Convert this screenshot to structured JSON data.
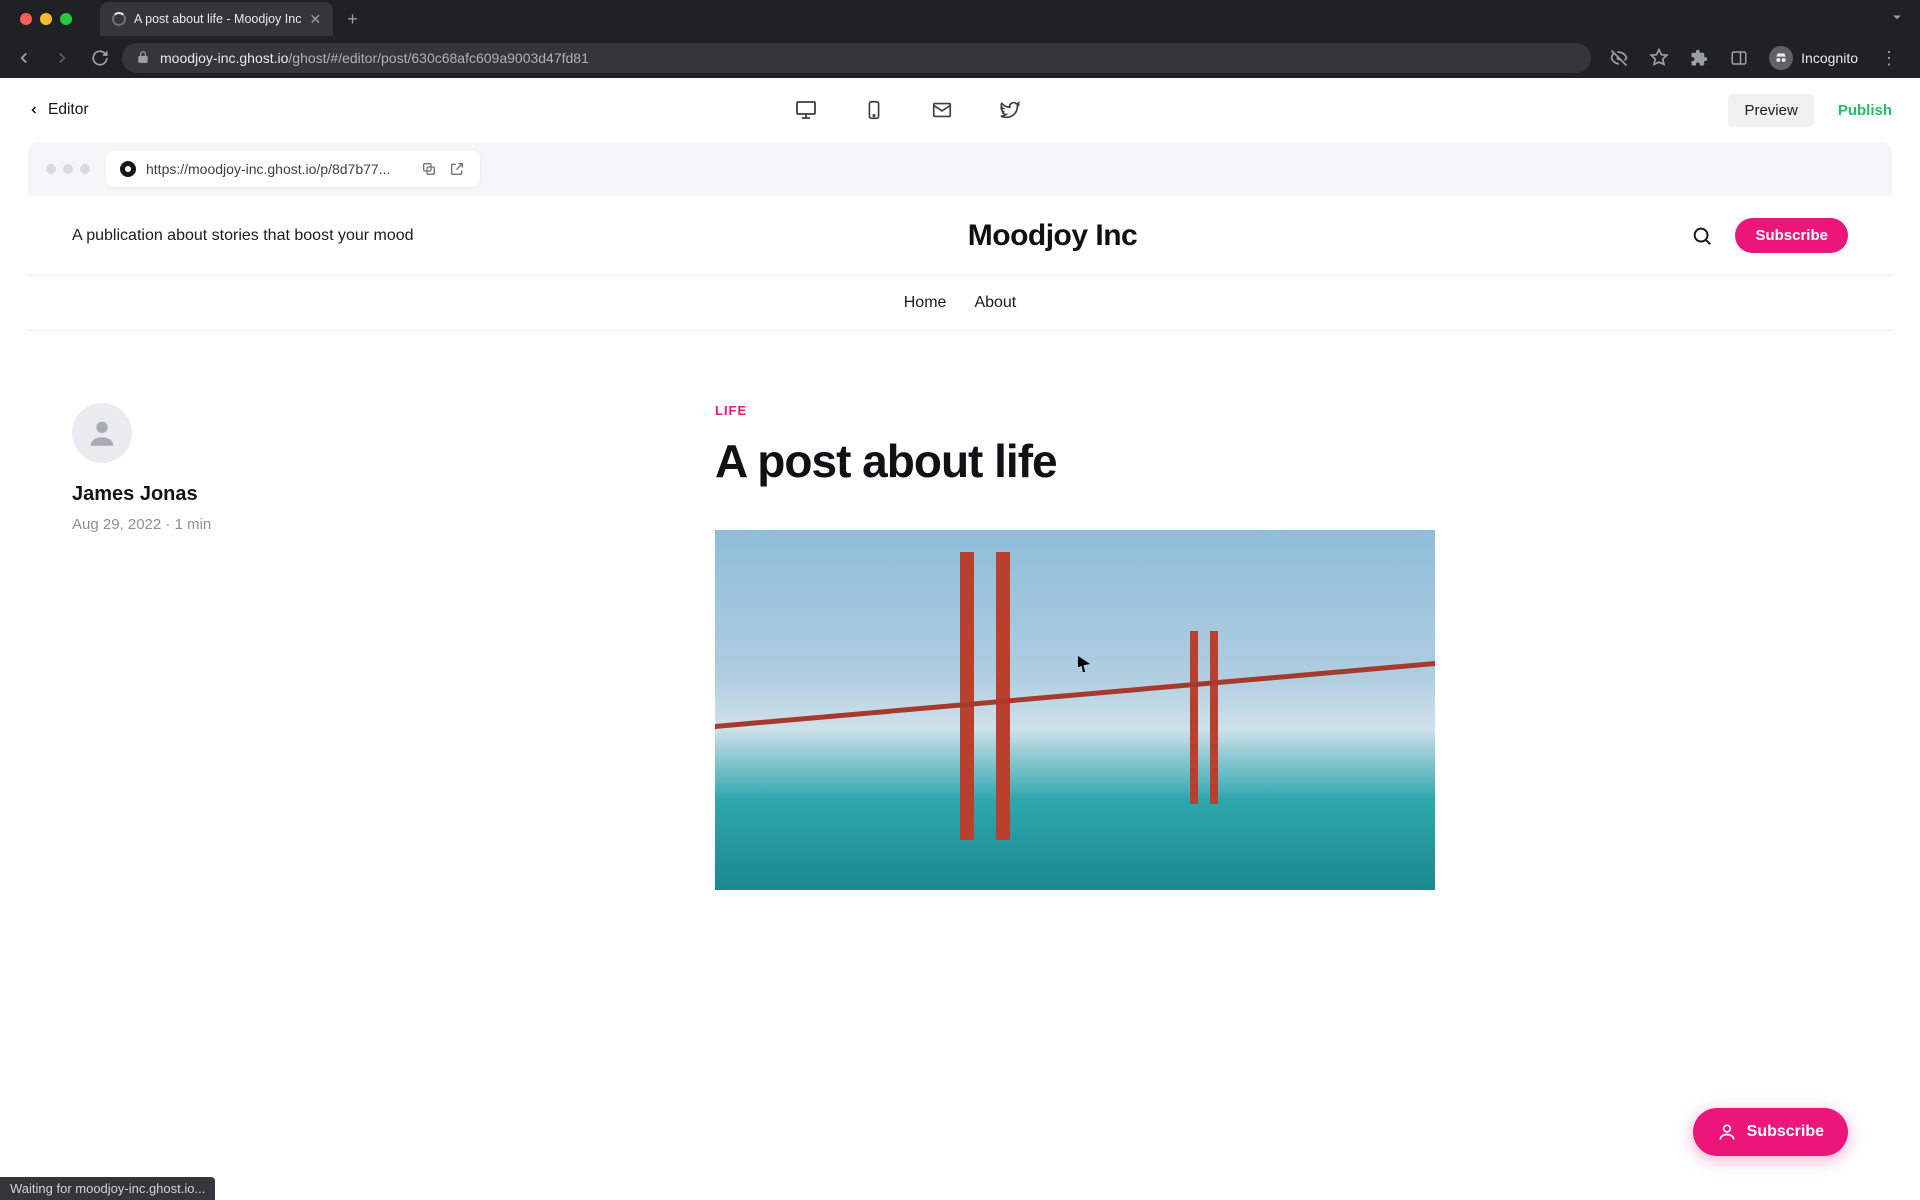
{
  "browser": {
    "tab_title": "A post about life - Moodjoy Inc",
    "url_host": "moodjoy-inc.ghost.io",
    "url_path": "/ghost/#/editor/post/630c68afc609a9003d47fd81",
    "incognito_label": "Incognito",
    "status_text": "Waiting for moodjoy-inc.ghost.io..."
  },
  "editor_bar": {
    "back_label": "Editor",
    "preview_label": "Preview",
    "publish_label": "Publish"
  },
  "preview_frame": {
    "url": "https://moodjoy-inc.ghost.io/p/8d7b77..."
  },
  "site": {
    "tagline": "A publication about stories that boost your mood",
    "title": "Moodjoy Inc",
    "subscribe_label": "Subscribe",
    "nav": {
      "home": "Home",
      "about": "About"
    }
  },
  "post": {
    "category": "LIFE",
    "title": "A post about life",
    "author": "James Jonas",
    "date": "Aug 29, 2022",
    "read_time": "1 min"
  },
  "floating": {
    "subscribe_label": "Subscribe"
  }
}
